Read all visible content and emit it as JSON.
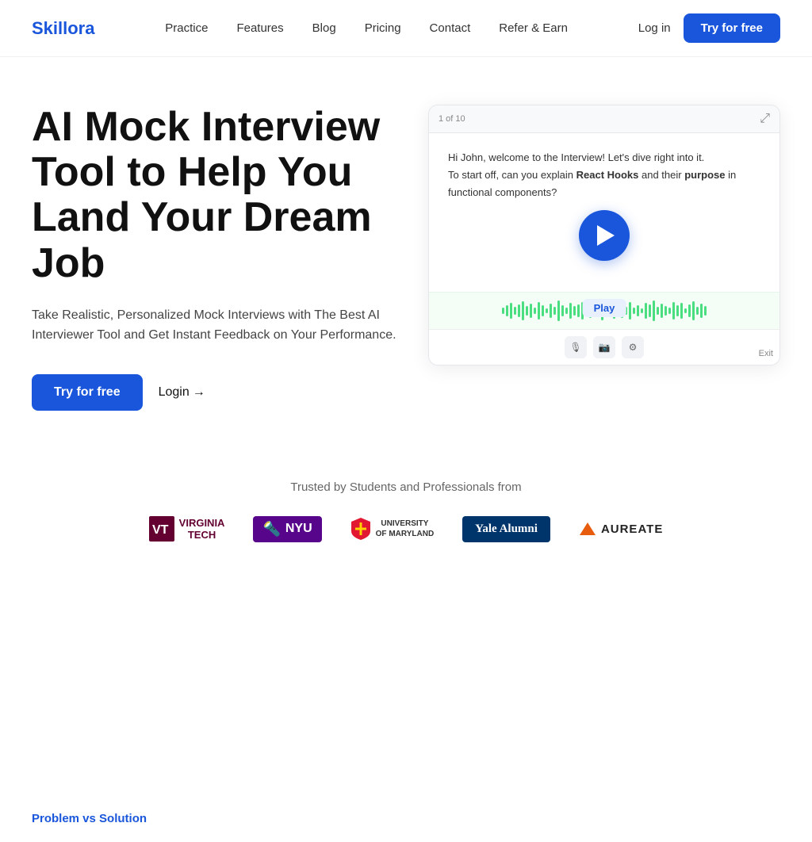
{
  "brand": {
    "name": "Skillora",
    "color": "#1a56db"
  },
  "nav": {
    "links": [
      {
        "id": "practice",
        "label": "Practice"
      },
      {
        "id": "features",
        "label": "Features"
      },
      {
        "id": "blog",
        "label": "Blog"
      },
      {
        "id": "pricing",
        "label": "Pricing"
      },
      {
        "id": "contact",
        "label": "Contact"
      },
      {
        "id": "refer",
        "label": "Refer & Earn"
      }
    ],
    "login_label": "Log in",
    "try_label": "Try for free"
  },
  "hero": {
    "title": "AI Mock Interview Tool to Help You Land Your Dream Job",
    "subtitle": "Take Realistic, Personalized Mock Interviews with The Best AI Interviewer Tool and Get Instant Feedback on Your Performance.",
    "try_label": "Try for free",
    "login_label": "Login",
    "video": {
      "counter": "1 of 10",
      "interview_line1": "Hi John, welcome to the Interview! Let's dive right into it.",
      "interview_line2": "To start off, can you explain ",
      "bold1": "React Hooks",
      "interview_line3": " and their ",
      "bold2": "purpose",
      "interview_line4": " in functional components?",
      "play_label": "Play"
    }
  },
  "trusted": {
    "text": "Trusted by Students and Professionals from",
    "logos": [
      {
        "id": "virginia-tech",
        "label": "Virginia Tech"
      },
      {
        "id": "nyu",
        "label": "NYU"
      },
      {
        "id": "umd",
        "label": "University of Maryland"
      },
      {
        "id": "yale",
        "label": "Yale Alumni"
      },
      {
        "id": "aureate",
        "label": "AUREATE"
      }
    ]
  },
  "problem_section": {
    "label": "Problem vs Solution"
  }
}
